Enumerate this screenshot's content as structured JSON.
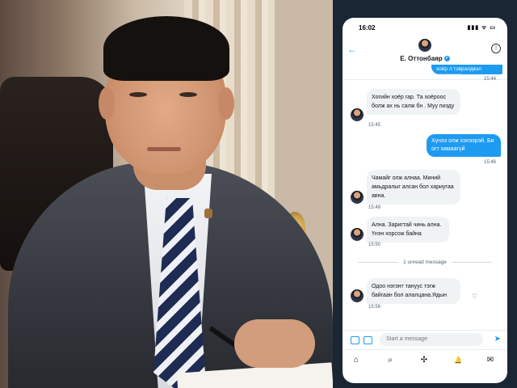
{
  "status_bar": {
    "time": "16:02",
    "indicators": "▮▮▮ ᯤ ▭"
  },
  "header": {
    "back_icon": "←",
    "name": "Е. Оттонбаяр",
    "info_icon": "i",
    "verified_icon": "✓"
  },
  "messages": [
    {
      "direction": "out",
      "text": "хоёр л тэврэлдвэл мэндэлдэг",
      "time": "15:44"
    },
    {
      "direction": "in",
      "text": "Хогийн хоёр гар. Та хоёроос болж ах нь салж бн . Муу пизду",
      "time": "15:45"
    },
    {
      "direction": "out",
      "text": "Хүнээ олж хэлээрэй. Би огт хамаагүй",
      "time": "15:46"
    },
    {
      "direction": "in",
      "text": "Чамайг олж алнаа. Миний амьдралыг алсан бол хариугаа авна.",
      "time": "15:48"
    },
    {
      "direction": "in",
      "text": "Ална. Заригтай чинь ална. Үнэн хорсож байна",
      "time": "15:50"
    },
    {
      "direction": "in",
      "text": "Одоо нэгэнт тануус тэгж байгаан бол алалцана.Ядын",
      "time": "15:56"
    }
  ],
  "unread_divider": "1 unread message",
  "composer": {
    "placeholder": "Start a message",
    "send_icon": "➤"
  },
  "tabbar": {
    "home_icon": "⌂",
    "search_icon": "⌕",
    "spaces_icon": "✣",
    "notifications_icon": "🔔",
    "messages_icon": "✉"
  },
  "react_icon": "♡",
  "colors": {
    "accent": "#1d9bf0",
    "bubble_in": "#eff3f4",
    "text": "#0f1419",
    "muted": "#536471"
  }
}
